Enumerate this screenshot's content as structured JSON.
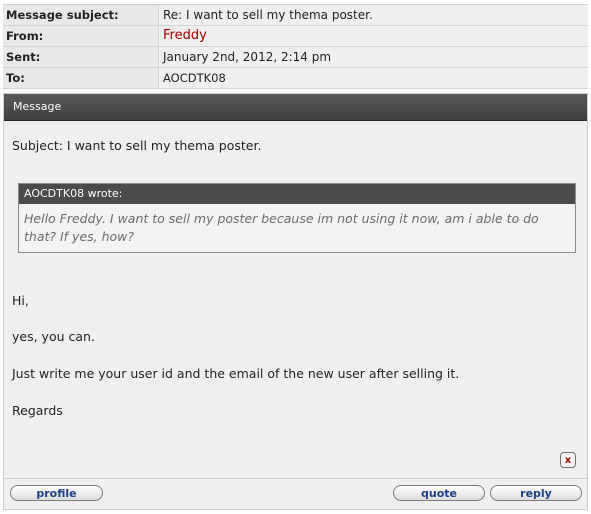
{
  "header": {
    "subject_label": "Message subject:",
    "subject_value": "Re: I want to sell my thema poster.",
    "from_label": "From:",
    "from_value": "Freddy",
    "sent_label": "Sent:",
    "sent_value": "January 2nd, 2012, 2:14 pm",
    "to_label": "To:",
    "to_value": "AOCDTK08"
  },
  "message": {
    "panel_title": "Message",
    "subject_line": "Subject: I want to sell my thema poster.",
    "quote": {
      "author_line": "AOCDTK08 wrote:",
      "text": "Hello Freddy. I want to sell my poster because im not using it now, am i able to do that? If yes, how?"
    },
    "body": [
      "Hi,",
      "yes, you can.",
      "Just write me your user id and the email of the new user after selling it.",
      "Regards"
    ],
    "close_glyph": "x"
  },
  "actions": {
    "profile_label": "profile",
    "quote_label": "quote",
    "reply_label": "reply"
  },
  "colors": {
    "author": "#a00000",
    "panel_header": "#444444",
    "button_text": "#1e3f8a"
  }
}
